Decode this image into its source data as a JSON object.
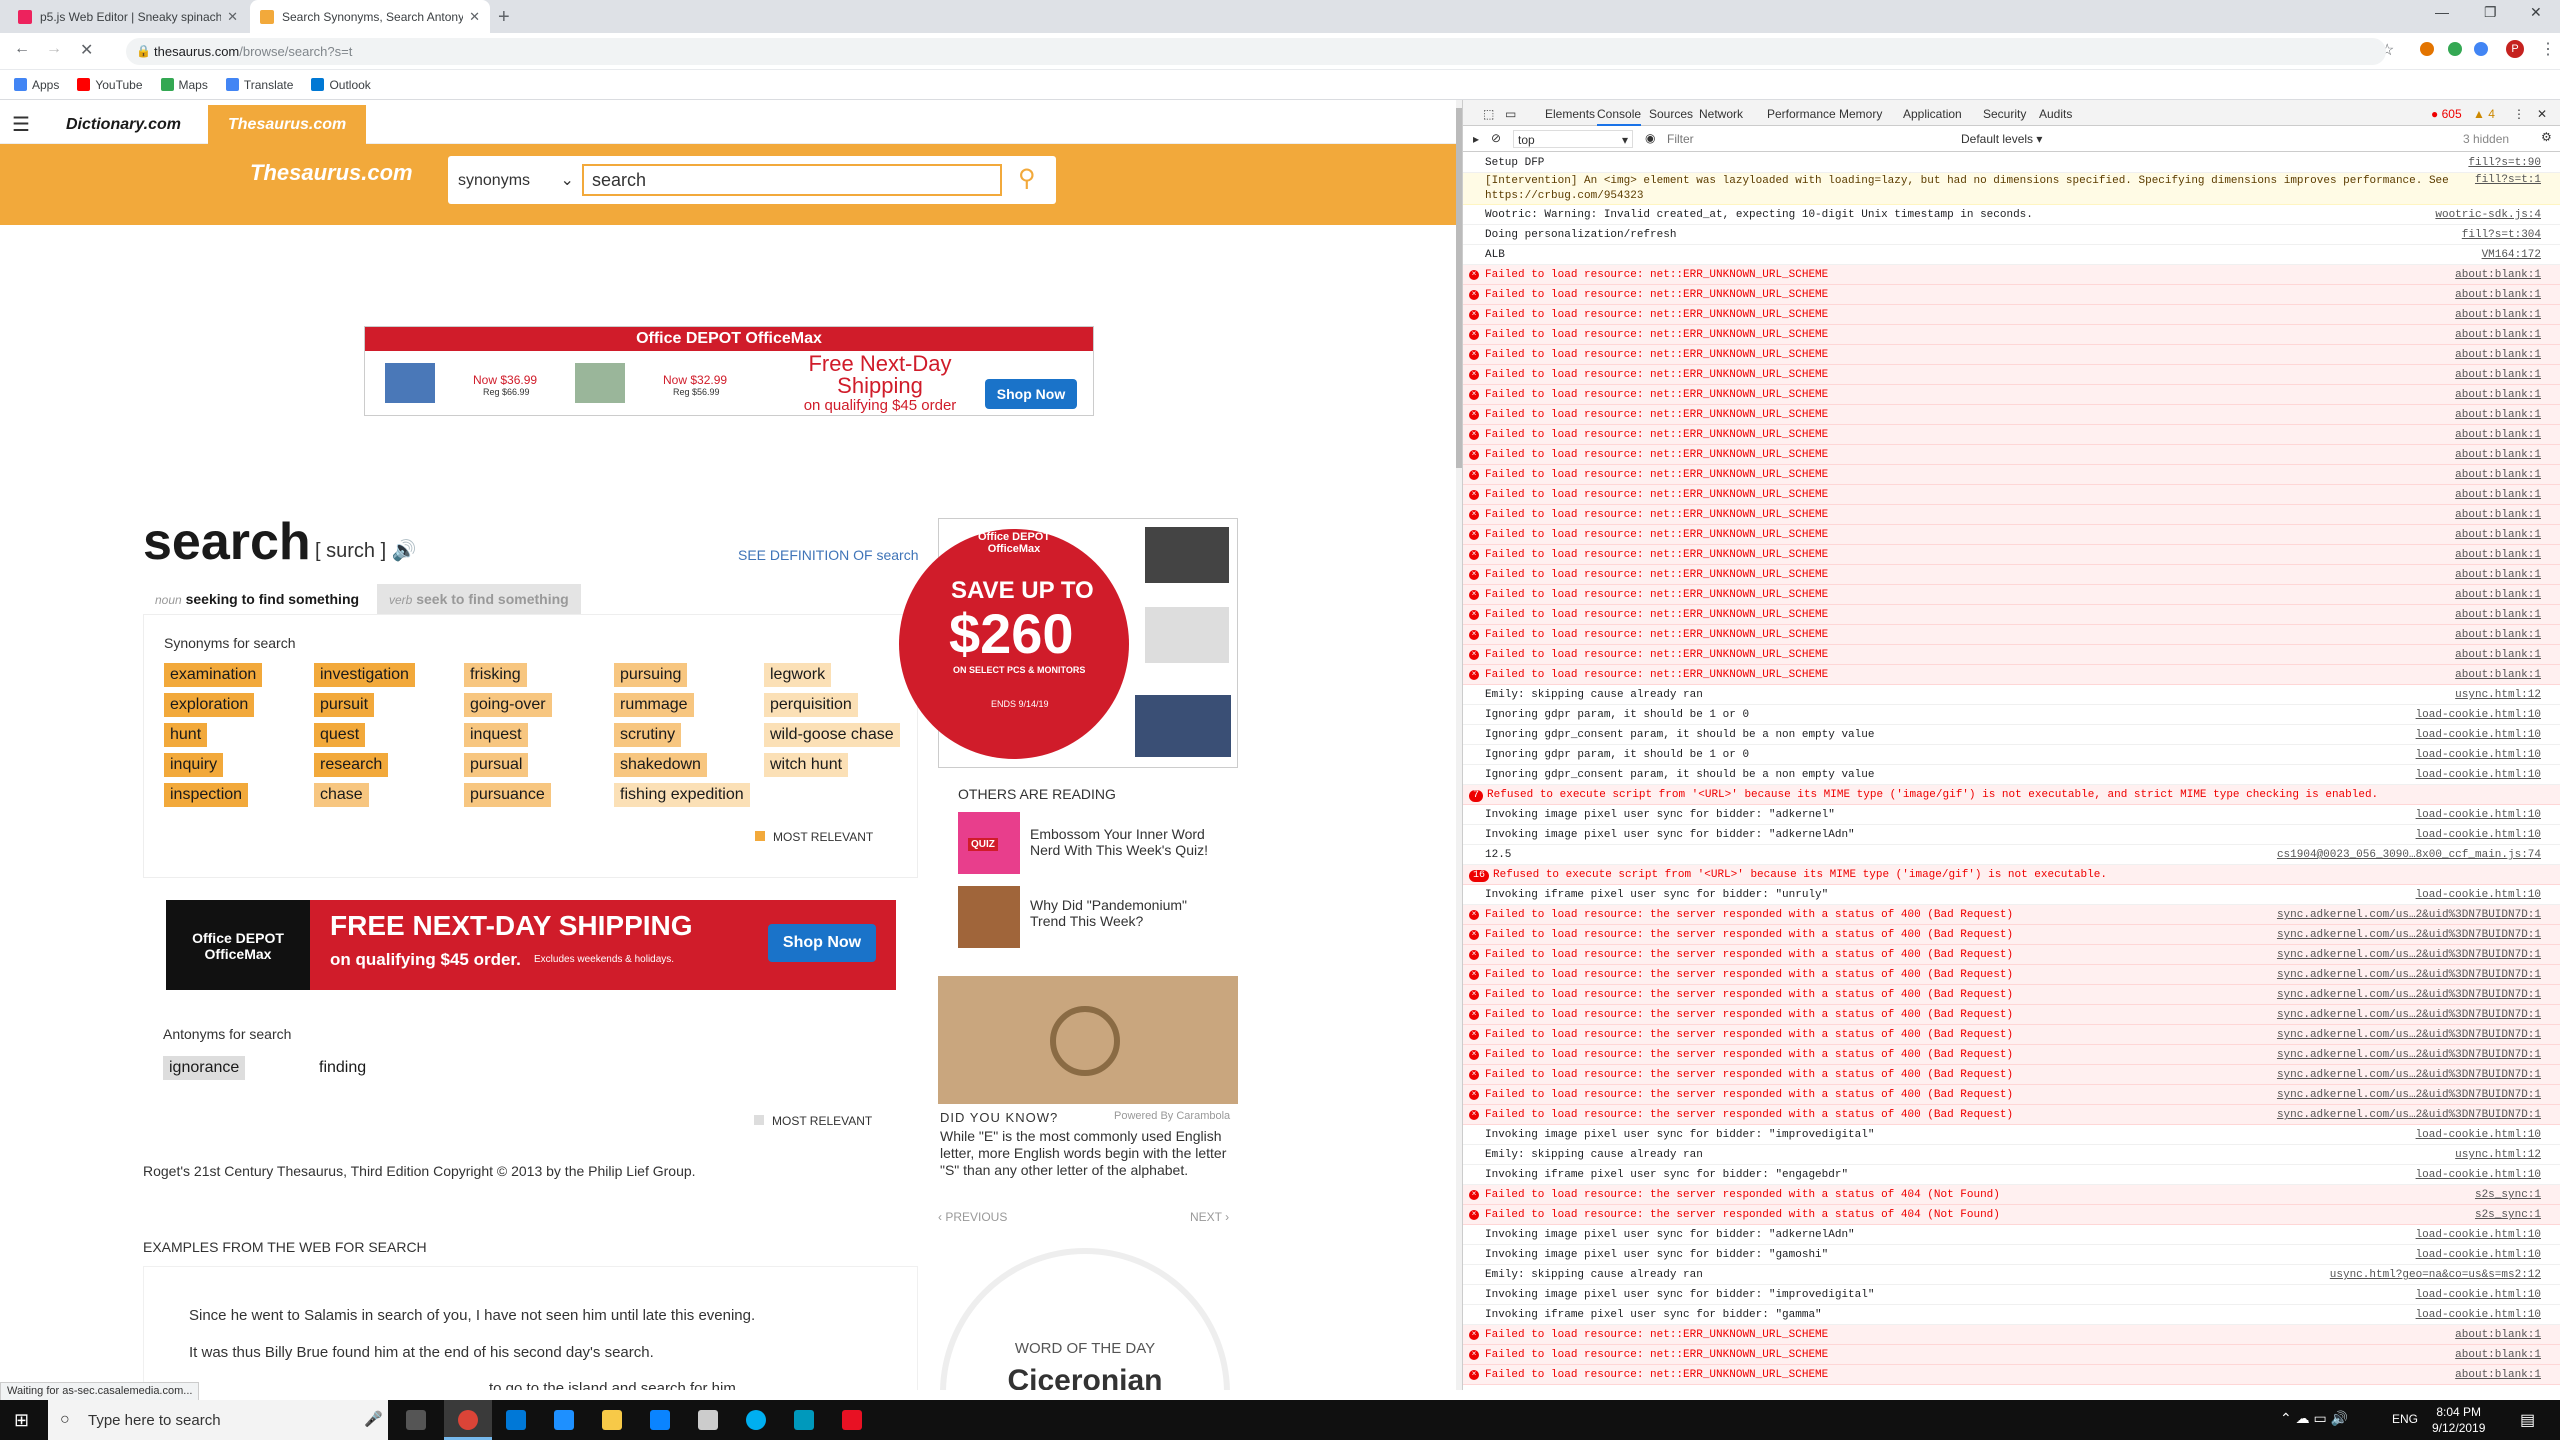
{
  "browser": {
    "tabs": [
      {
        "title": "p5.js Web Editor | Sneaky spinach",
        "active": false,
        "favicon_color": "#ed225d"
      },
      {
        "title": "Search Synonyms, Search Antonyms",
        "active": true,
        "favicon_color": "#f2a93b"
      }
    ],
    "url_host": "thesaurus.com",
    "url_path": "/browse/search?s=t",
    "bookmarks": [
      {
        "label": "Apps",
        "color": "#4285f4"
      },
      {
        "label": "YouTube",
        "color": "#ff0000"
      },
      {
        "label": "Maps",
        "color": "#34a853"
      },
      {
        "label": "Translate",
        "color": "#4285f4"
      },
      {
        "label": "Outlook",
        "color": "#0078d4"
      }
    ],
    "status": "Waiting for as-sec.casalemedia.com..."
  },
  "site": {
    "tabs": [
      "Dictionary.com",
      "Thesaurus.com"
    ],
    "logo": "Thesaurus.com",
    "search_type": "synonyms",
    "search_value": "search",
    "ad_top": {
      "brand": "Office DEPOT OfficeMax",
      "price1": "Now $36.99",
      "price1_reg": "Reg $66.99",
      "price2": "Now $32.99",
      "price2_reg": "Reg $56.99",
      "headline": "Free Next-Day Shipping",
      "sub": "on qualifying $45 order",
      "cta": "Shop Now"
    },
    "word": "search",
    "pronunciation": "[ surch ]",
    "see_definition": "SEE DEFINITION OF search",
    "pos_tabs": [
      {
        "pos": "noun",
        "label": "seeking to find something"
      },
      {
        "pos": "verb",
        "label": "seek to find something"
      }
    ],
    "synonyms_label": "Synonyms for search",
    "synonyms": [
      {
        "word": "examination",
        "rel": 3
      },
      {
        "word": "exploration",
        "rel": 3
      },
      {
        "word": "hunt",
        "rel": 3
      },
      {
        "word": "inquiry",
        "rel": 3
      },
      {
        "word": "inspection",
        "rel": 3
      },
      {
        "word": "investigation",
        "rel": 3
      },
      {
        "word": "pursuit",
        "rel": 3
      },
      {
        "word": "quest",
        "rel": 3
      },
      {
        "word": "research",
        "rel": 3
      },
      {
        "word": "chase",
        "rel": 2
      },
      {
        "word": "frisking",
        "rel": 2
      },
      {
        "word": "going-over",
        "rel": 2
      },
      {
        "word": "inquest",
        "rel": 2
      },
      {
        "word": "pursual",
        "rel": 2
      },
      {
        "word": "pursuance",
        "rel": 2
      },
      {
        "word": "pursuing",
        "rel": 2
      },
      {
        "word": "rummage",
        "rel": 2
      },
      {
        "word": "scrutiny",
        "rel": 2
      },
      {
        "word": "shakedown",
        "rel": 2
      },
      {
        "word": "fishing expedition",
        "rel": 1
      },
      {
        "word": "legwork",
        "rel": 1
      },
      {
        "word": "perquisition",
        "rel": 1
      },
      {
        "word": "wild-goose chase",
        "rel": 1
      },
      {
        "word": "witch hunt",
        "rel": 1
      }
    ],
    "most_relevant": "MOST RELEVANT",
    "ad_mid": {
      "brand": "Office DEPOT OfficeMax",
      "headline": "FREE NEXT-DAY SHIPPING",
      "sub": "on qualifying $45 order.",
      "fine": "Excludes weekends & holidays.",
      "cta": "Shop Now"
    },
    "antonyms_label": "Antonyms for search",
    "antonyms": [
      {
        "word": "ignorance",
        "rel": 2
      },
      {
        "word": "finding",
        "rel": 1
      }
    ],
    "copyright": "Roget's 21st Century Thesaurus, Third Edition Copyright © 2013 by the Philip Lief Group.",
    "examples_heading": "EXAMPLES FROM THE WEB FOR SEARCH",
    "examples": [
      "Since he went to Salamis in search of you, I have not seen him until late this evening.",
      "It was thus Billy Brue found him at the end of his second day's search.",
      "to go to the island and search for him."
    ],
    "ad_side": {
      "brand": "Office DEPOT OfficeMax",
      "save": "SAVE UP TO",
      "amount": "$260",
      "sub": "ON SELECT PCS & MONITORS",
      "ends": "ENDS 9/14/19"
    },
    "others_heading": "OTHERS ARE READING",
    "reading": [
      {
        "title": "Embossom Your Inner Word Nerd With This Week's Quiz!",
        "badge": "QUIZ"
      },
      {
        "title": "Why Did \"Pandemonium\" Trend This Week?"
      }
    ],
    "powered_by": "Powered By Carambola",
    "dyk_heading": "DID YOU KNOW?",
    "dyk_text": "While \"E\" is the most commonly used English letter, more English words begin with the letter \"S\" than any other letter of the alphabet.",
    "prev": "‹ PREVIOUS",
    "next": "NEXT ›",
    "wotd_label": "WORD OF THE DAY",
    "wotd_word": "Ciceronian"
  },
  "devtools": {
    "tabs": [
      "Elements",
      "Console",
      "Sources",
      "Network",
      "Performance",
      "Memory",
      "Application",
      "Security",
      "Audits"
    ],
    "active_tab": "Console",
    "error_count": "605",
    "warn_count": "4",
    "context": "top",
    "filter_placeholder": "Filter",
    "levels": "Default levels ▾",
    "hidden": "3 hidden",
    "lines": [
      {
        "t": "info",
        "msg": "Setup DFP",
        "src": "fill?s=t:90"
      },
      {
        "t": "warn",
        "msg": "[Intervention] An <img> element was lazyloaded with loading=lazy, but had no dimensions specified. Specifying dimensions improves performance. See https://crbug.com/954323",
        "src": "fill?s=t:1"
      },
      {
        "t": "info",
        "msg": "Wootric: Warning: Invalid created_at, expecting 10-digit Unix timestamp in seconds.",
        "src": "wootric-sdk.js:4"
      },
      {
        "t": "info",
        "msg": "Doing personalization/refresh",
        "src": "fill?s=t:304"
      },
      {
        "t": "info",
        "msg": "ALB",
        "src": "VM164:172"
      },
      {
        "t": "err",
        "msg": "Failed to load resource: net::ERR_UNKNOWN_URL_SCHEME",
        "src": "about:blank:1"
      },
      {
        "t": "err",
        "msg": "Failed to load resource: net::ERR_UNKNOWN_URL_SCHEME",
        "src": "about:blank:1"
      },
      {
        "t": "err",
        "msg": "Failed to load resource: net::ERR_UNKNOWN_URL_SCHEME",
        "src": "about:blank:1"
      },
      {
        "t": "err",
        "msg": "Failed to load resource: net::ERR_UNKNOWN_URL_SCHEME",
        "src": "about:blank:1"
      },
      {
        "t": "err",
        "msg": "Failed to load resource: net::ERR_UNKNOWN_URL_SCHEME",
        "src": "about:blank:1"
      },
      {
        "t": "err",
        "msg": "Failed to load resource: net::ERR_UNKNOWN_URL_SCHEME",
        "src": "about:blank:1"
      },
      {
        "t": "err",
        "msg": "Failed to load resource: net::ERR_UNKNOWN_URL_SCHEME",
        "src": "about:blank:1"
      },
      {
        "t": "err",
        "msg": "Failed to load resource: net::ERR_UNKNOWN_URL_SCHEME",
        "src": "about:blank:1"
      },
      {
        "t": "err",
        "msg": "Failed to load resource: net::ERR_UNKNOWN_URL_SCHEME",
        "src": "about:blank:1"
      },
      {
        "t": "err",
        "msg": "Failed to load resource: net::ERR_UNKNOWN_URL_SCHEME",
        "src": "about:blank:1"
      },
      {
        "t": "err",
        "msg": "Failed to load resource: net::ERR_UNKNOWN_URL_SCHEME",
        "src": "about:blank:1"
      },
      {
        "t": "err",
        "msg": "Failed to load resource: net::ERR_UNKNOWN_URL_SCHEME",
        "src": "about:blank:1"
      },
      {
        "t": "err",
        "msg": "Failed to load resource: net::ERR_UNKNOWN_URL_SCHEME",
        "src": "about:blank:1"
      },
      {
        "t": "err",
        "msg": "Failed to load resource: net::ERR_UNKNOWN_URL_SCHEME",
        "src": "about:blank:1"
      },
      {
        "t": "err",
        "msg": "Failed to load resource: net::ERR_UNKNOWN_URL_SCHEME",
        "src": "about:blank:1"
      },
      {
        "t": "err",
        "msg": "Failed to load resource: net::ERR_UNKNOWN_URL_SCHEME",
        "src": "about:blank:1"
      },
      {
        "t": "err",
        "msg": "Failed to load resource: net::ERR_UNKNOWN_URL_SCHEME",
        "src": "about:blank:1"
      },
      {
        "t": "err",
        "msg": "Failed to load resource: net::ERR_UNKNOWN_URL_SCHEME",
        "src": "about:blank:1"
      },
      {
        "t": "err",
        "msg": "Failed to load resource: net::ERR_UNKNOWN_URL_SCHEME",
        "src": "about:blank:1"
      },
      {
        "t": "err",
        "msg": "Failed to load resource: net::ERR_UNKNOWN_URL_SCHEME",
        "src": "about:blank:1"
      },
      {
        "t": "err",
        "msg": "Failed to load resource: net::ERR_UNKNOWN_URL_SCHEME",
        "src": "about:blank:1"
      },
      {
        "t": "info",
        "msg": "Emily: skipping cause already ran",
        "src": "usync.html:12"
      },
      {
        "t": "info",
        "msg": "Ignoring gdpr param, it should be 1 or 0",
        "src": "load-cookie.html:10"
      },
      {
        "t": "info",
        "msg": "Ignoring gdpr_consent param, it should be a non empty value",
        "src": "load-cookie.html:10"
      },
      {
        "t": "info",
        "msg": "Ignoring gdpr param, it should be 1 or 0",
        "src": "load-cookie.html:10"
      },
      {
        "t": "info",
        "msg": "Ignoring gdpr_consent param, it should be a non empty value",
        "src": "load-cookie.html:10"
      },
      {
        "t": "err",
        "count": "7",
        "msg": "Refused to execute script from '<URL>' because its MIME type ('image/gif') is not executable, and strict MIME type checking is enabled.",
        "src": ""
      },
      {
        "t": "info",
        "msg": "Invoking image pixel user sync for bidder: \"adkernel\"",
        "src": "load-cookie.html:10"
      },
      {
        "t": "info",
        "msg": "Invoking image pixel user sync for bidder: \"adkernelAdn\"",
        "src": "load-cookie.html:10"
      },
      {
        "t": "info",
        "msg": "12.5",
        "src": "cs1904@0023_056_3090…8x00_ccf_main.js:74"
      },
      {
        "t": "err",
        "count": "16",
        "msg": "Refused to execute script from '<URL>' because its MIME type ('image/gif') is not executable.",
        "src": ""
      },
      {
        "t": "info",
        "msg": "Invoking iframe pixel user sync for bidder: \"unruly\"",
        "src": "load-cookie.html:10"
      },
      {
        "t": "err",
        "msg": "Failed to load resource: the server responded with a status of 400 (Bad Request)",
        "src": "sync.adkernel.com/us…2&uid%3DN7BUIDN7D:1"
      },
      {
        "t": "err",
        "msg": "Failed to load resource: the server responded with a status of 400 (Bad Request)",
        "src": "sync.adkernel.com/us…2&uid%3DN7BUIDN7D:1"
      },
      {
        "t": "err",
        "msg": "Failed to load resource: the server responded with a status of 400 (Bad Request)",
        "src": "sync.adkernel.com/us…2&uid%3DN7BUIDN7D:1"
      },
      {
        "t": "err",
        "msg": "Failed to load resource: the server responded with a status of 400 (Bad Request)",
        "src": "sync.adkernel.com/us…2&uid%3DN7BUIDN7D:1"
      },
      {
        "t": "err",
        "msg": "Failed to load resource: the server responded with a status of 400 (Bad Request)",
        "src": "sync.adkernel.com/us…2&uid%3DN7BUIDN7D:1"
      },
      {
        "t": "err",
        "msg": "Failed to load resource: the server responded with a status of 400 (Bad Request)",
        "src": "sync.adkernel.com/us…2&uid%3DN7BUIDN7D:1"
      },
      {
        "t": "err",
        "msg": "Failed to load resource: the server responded with a status of 400 (Bad Request)",
        "src": "sync.adkernel.com/us…2&uid%3DN7BUIDN7D:1"
      },
      {
        "t": "err",
        "msg": "Failed to load resource: the server responded with a status of 400 (Bad Request)",
        "src": "sync.adkernel.com/us…2&uid%3DN7BUIDN7D:1"
      },
      {
        "t": "err",
        "msg": "Failed to load resource: the server responded with a status of 400 (Bad Request)",
        "src": "sync.adkernel.com/us…2&uid%3DN7BUIDN7D:1"
      },
      {
        "t": "err",
        "msg": "Failed to load resource: the server responded with a status of 400 (Bad Request)",
        "src": "sync.adkernel.com/us…2&uid%3DN7BUIDN7D:1"
      },
      {
        "t": "err",
        "msg": "Failed to load resource: the server responded with a status of 400 (Bad Request)",
        "src": "sync.adkernel.com/us…2&uid%3DN7BUIDN7D:1"
      },
      {
        "t": "info",
        "msg": "Invoking image pixel user sync for bidder: \"improvedigital\"",
        "src": "load-cookie.html:10"
      },
      {
        "t": "info",
        "msg": "Emily: skipping cause already ran",
        "src": "usync.html:12"
      },
      {
        "t": "info",
        "msg": "Invoking iframe pixel user sync for bidder: \"engagebdr\"",
        "src": "load-cookie.html:10"
      },
      {
        "t": "err",
        "msg": "Failed to load resource: the server responded with a status of 404 (Not Found)",
        "src": "s2s_sync:1"
      },
      {
        "t": "err",
        "msg": "Failed to load resource: the server responded with a status of 404 (Not Found)",
        "src": "s2s_sync:1"
      },
      {
        "t": "info",
        "msg": "Invoking image pixel user sync for bidder: \"adkernelAdn\"",
        "src": "load-cookie.html:10"
      },
      {
        "t": "info",
        "msg": "Invoking image pixel user sync for bidder: \"gamoshi\"",
        "src": "load-cookie.html:10"
      },
      {
        "t": "info",
        "msg": "Emily: skipping cause already ran",
        "src": "usync.html?geo=na&co=us&s=ms2:12"
      },
      {
        "t": "info",
        "msg": "Invoking image pixel user sync for bidder: \"improvedigital\"",
        "src": "load-cookie.html:10"
      },
      {
        "t": "info",
        "msg": "Invoking iframe pixel user sync for bidder: \"gamma\"",
        "src": "load-cookie.html:10"
      },
      {
        "t": "err",
        "msg": "Failed to load resource: net::ERR_UNKNOWN_URL_SCHEME",
        "src": "about:blank:1"
      },
      {
        "t": "err",
        "msg": "Failed to load resource: net::ERR_UNKNOWN_URL_SCHEME",
        "src": "about:blank:1"
      },
      {
        "t": "err",
        "msg": "Failed to load resource: net::ERR_UNKNOWN_URL_SCHEME",
        "src": "about:blank:1"
      }
    ]
  },
  "taskbar": {
    "search_placeholder": "Type here to search",
    "lang": "ENG",
    "time": "8:04 PM",
    "date": "9/12/2019"
  }
}
